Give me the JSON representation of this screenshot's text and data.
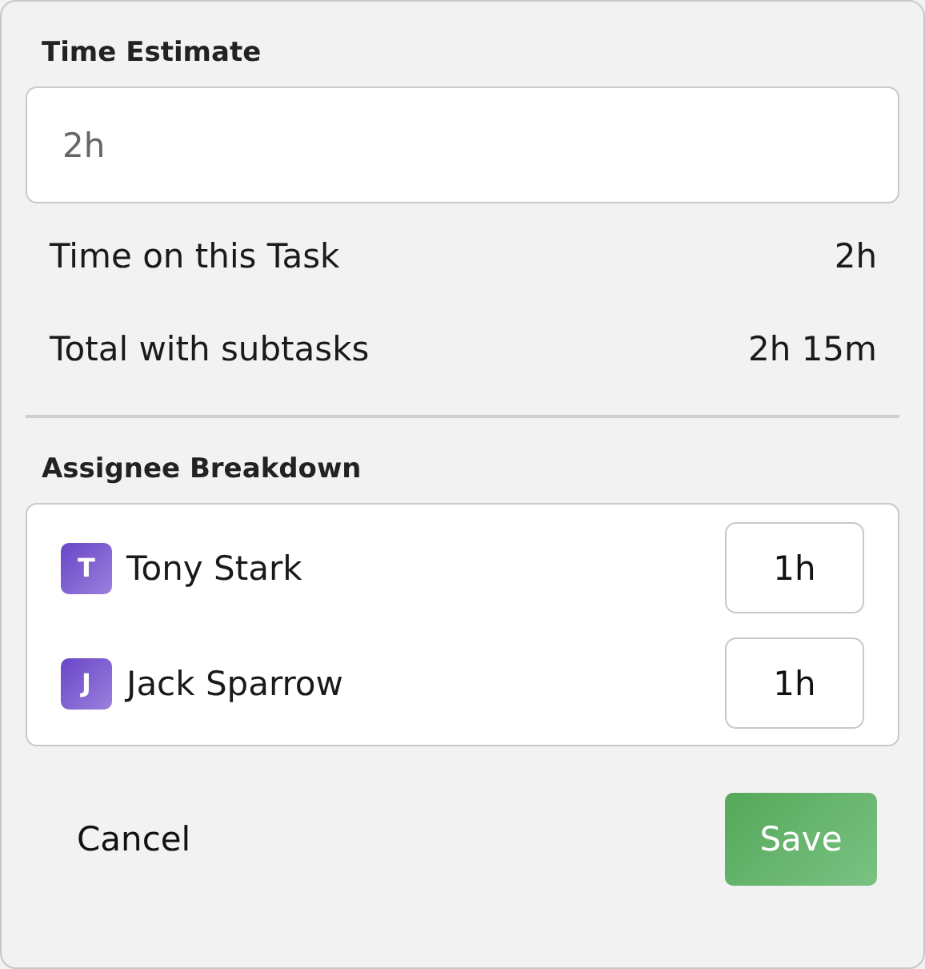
{
  "estimate": {
    "label": "Time Estimate",
    "placeholder": "2h"
  },
  "summary": [
    {
      "label": "Time on this Task",
      "value": "2h"
    },
    {
      "label": "Total with subtasks",
      "value": "2h 15m"
    }
  ],
  "breakdown": {
    "title": "Assignee Breakdown",
    "assignees": [
      {
        "initial": "T",
        "name": "Tony Stark",
        "hours": "1h"
      },
      {
        "initial": "J",
        "name": "Jack Sparrow",
        "hours": "1h"
      }
    ]
  },
  "actions": {
    "cancel": "Cancel",
    "save": "Save"
  }
}
